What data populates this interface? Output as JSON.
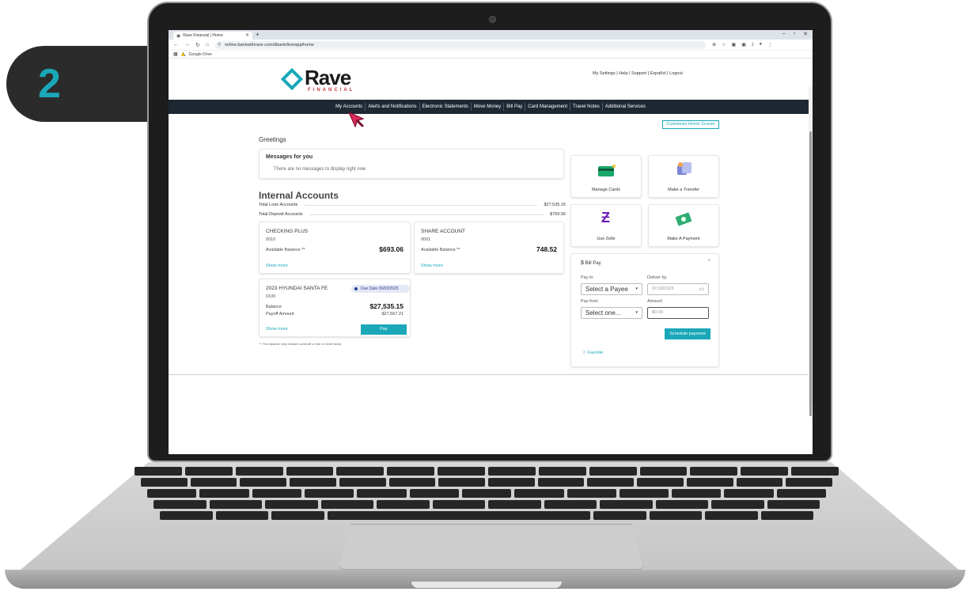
{
  "step": {
    "number": "2"
  },
  "browser": {
    "tab_title": "Rave Financial | Home",
    "url": "online.bankwithrave.com/dbank/live/app/home",
    "bookmark": "Google Drive"
  },
  "brand": {
    "name": "Rave",
    "subtitle": "FINANCIAL",
    "accent": "#1aa7b8",
    "nav_bg": "#1e2833"
  },
  "top_links": "My Settings | Help | Support | Español | Logout",
  "nav": [
    "My Accounts",
    "Alerts and Notifications",
    "Electronic Statements",
    "Move Money",
    "Bill Pay",
    "Card Management",
    "Travel Notes",
    "Additional Services"
  ],
  "customize_label": "Customize Home Screen",
  "greetings": "Greetings",
  "messages": {
    "title": "Messages for you",
    "empty": "There are no messages to display right now"
  },
  "internal": {
    "title": "Internal Accounts",
    "loan_label": "Total Loan Accounts",
    "loan_value": "$27,535.15",
    "deposit_label": "Total Deposit Accounts",
    "deposit_value": "$769.56"
  },
  "accounts": [
    {
      "name": "CHECKING PLUS",
      "number": "0010",
      "label": "Available Balance **",
      "balance": "$693.06",
      "more": "Show more"
    },
    {
      "name": "SHARE ACCOUNT",
      "number": "0001",
      "label": "Available Balance **",
      "balance": "748.52",
      "more": "Show more"
    }
  ],
  "loan": {
    "name": "2023 HYUNDAI SANTA FE",
    "number": "0100",
    "due": "Due Date 09/03/2025",
    "balance_label": "Balance",
    "balance": "$27,535.15",
    "payoff_label": "Payoff Amount",
    "payoff": "$27,567.21",
    "more": "Show more",
    "pay": "Pay"
  },
  "footnote": "** This balance may include overdraft or line of credit funds",
  "tiles": [
    "Manage Cards",
    "Make a Transfer",
    "Use Zelle",
    "Make A Payment"
  ],
  "billpay": {
    "title": "Bill Pay",
    "pay_to_label": "Pay to",
    "pay_to_value": "Select a Payee",
    "deliver_label": "Deliver by",
    "deliver_value": "07/18/2025",
    "pay_from_label": "Pay from",
    "pay_from_value": "Select one...",
    "amount_label": "Amount",
    "amount_placeholder": "$0.00",
    "schedule": "Schedule payment",
    "favorite": "Favorite"
  }
}
